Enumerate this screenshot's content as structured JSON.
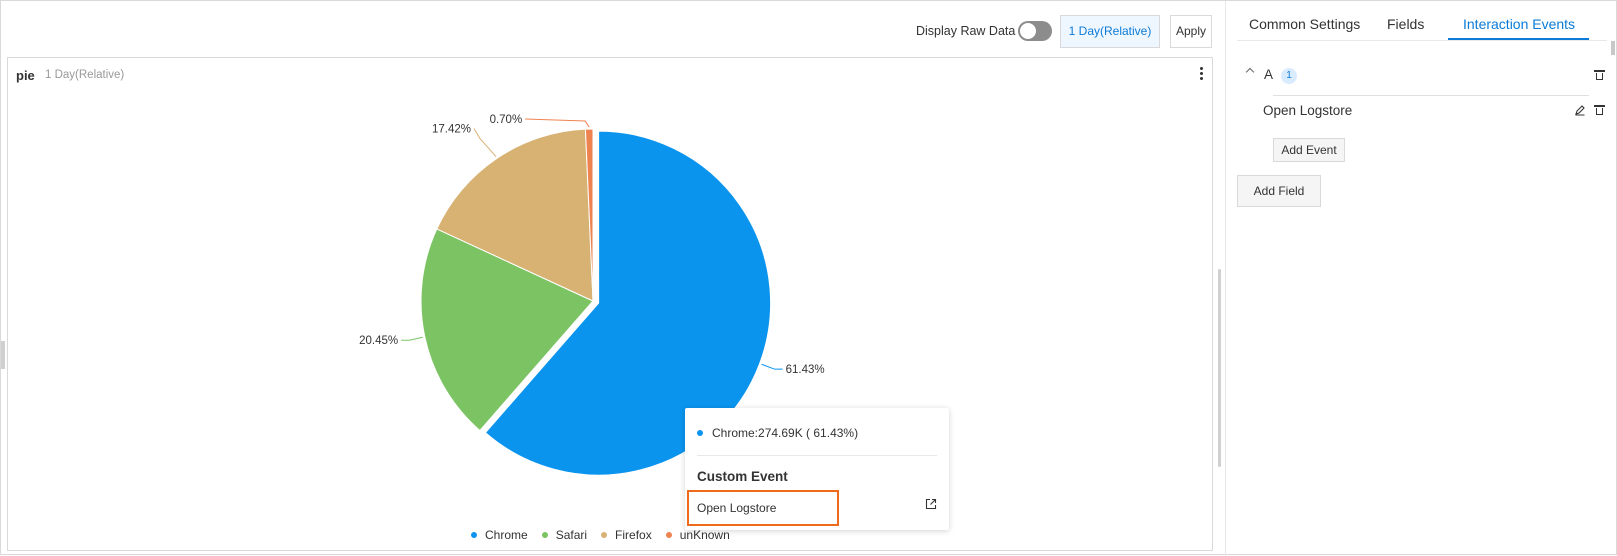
{
  "toolbar": {
    "raw_label": "Display Raw Data",
    "time_range": "1 Day(Relative)",
    "apply": "Apply"
  },
  "panel": {
    "title": "pie",
    "subtitle": "1 Day(Relative)"
  },
  "chart_data": {
    "type": "pie",
    "title": "pie",
    "slices": [
      {
        "name": "Chrome",
        "value": 61.43,
        "label": "61.43%",
        "color": "#0b94ee"
      },
      {
        "name": "Safari",
        "value": 20.45,
        "label": "20.45%",
        "color": "#7cc364"
      },
      {
        "name": "Firefox",
        "value": 17.42,
        "label": "17.42%",
        "color": "#d8b273"
      },
      {
        "name": "unKnown",
        "value": 0.7,
        "label": "0.70%",
        "color": "#ef8350"
      }
    ],
    "legend_position": "bottom",
    "highlighted": "Chrome"
  },
  "tooltip": {
    "entry": "Chrome:274.69K ( 61.43%)",
    "dot_color": "#0b94ee",
    "section_title": "Custom Event",
    "link": "Open Logstore"
  },
  "tabs": [
    {
      "label": "Common Settings",
      "active": false
    },
    {
      "label": "Fields",
      "active": false
    },
    {
      "label": "Interaction Events",
      "active": true
    }
  ],
  "group": {
    "name": "A",
    "count": "1",
    "event": "Open Logstore",
    "add_event": "Add Event",
    "add_field": "Add Field"
  },
  "colors": {
    "accent": "#0c7bd7",
    "highlight_border": "#ef6a1a"
  }
}
